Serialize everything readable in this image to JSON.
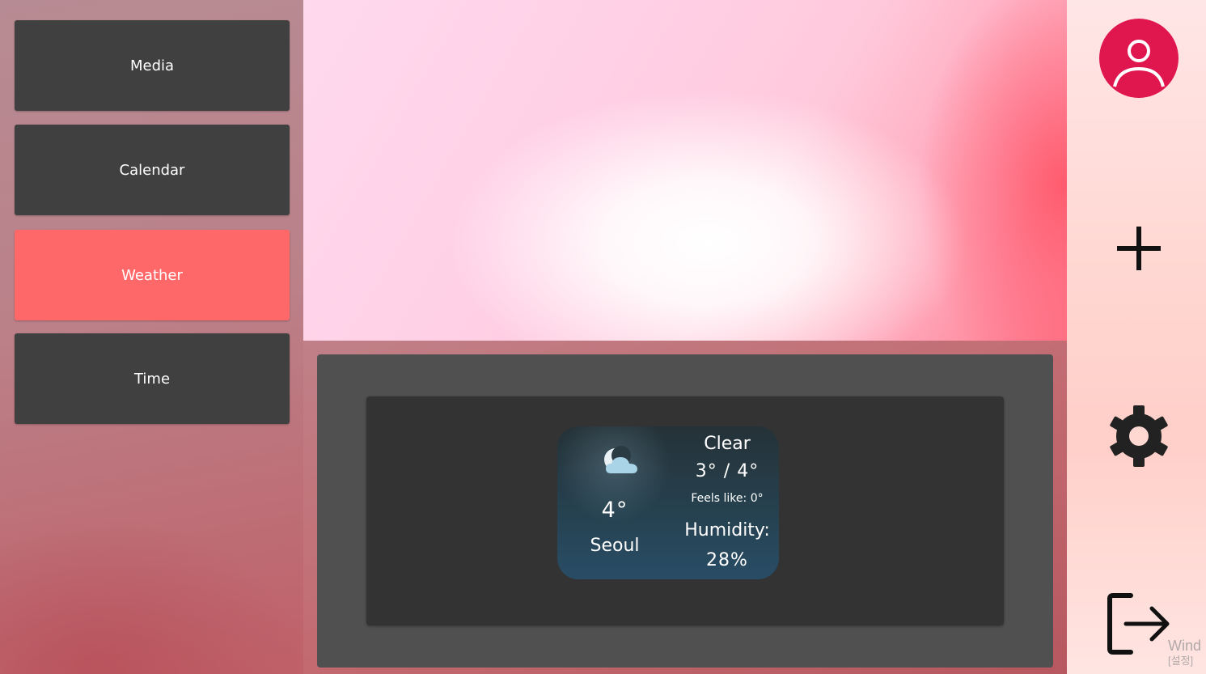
{
  "sidebar": {
    "items": [
      {
        "label": "Media",
        "active": false
      },
      {
        "label": "Calendar",
        "active": false
      },
      {
        "label": "Weather",
        "active": true
      },
      {
        "label": "Time",
        "active": false
      }
    ],
    "active_color": "#ff6868",
    "item_color": "#404040"
  },
  "weather": {
    "icon": "moon-cloud-icon",
    "temperature": "4°",
    "city": "Seoul",
    "condition": "Clear",
    "range": "3° / 4°",
    "feels_like": "Feels like: 0°",
    "humidity_label": "Humidity:",
    "humidity_value": "28%"
  },
  "toolbar": {
    "icons": [
      "user-icon",
      "add-icon",
      "gear-icon",
      "logout-icon"
    ],
    "avatar_color": "#e0174f"
  },
  "watermark": {
    "line1": "Wind",
    "line2": "[설정]"
  }
}
